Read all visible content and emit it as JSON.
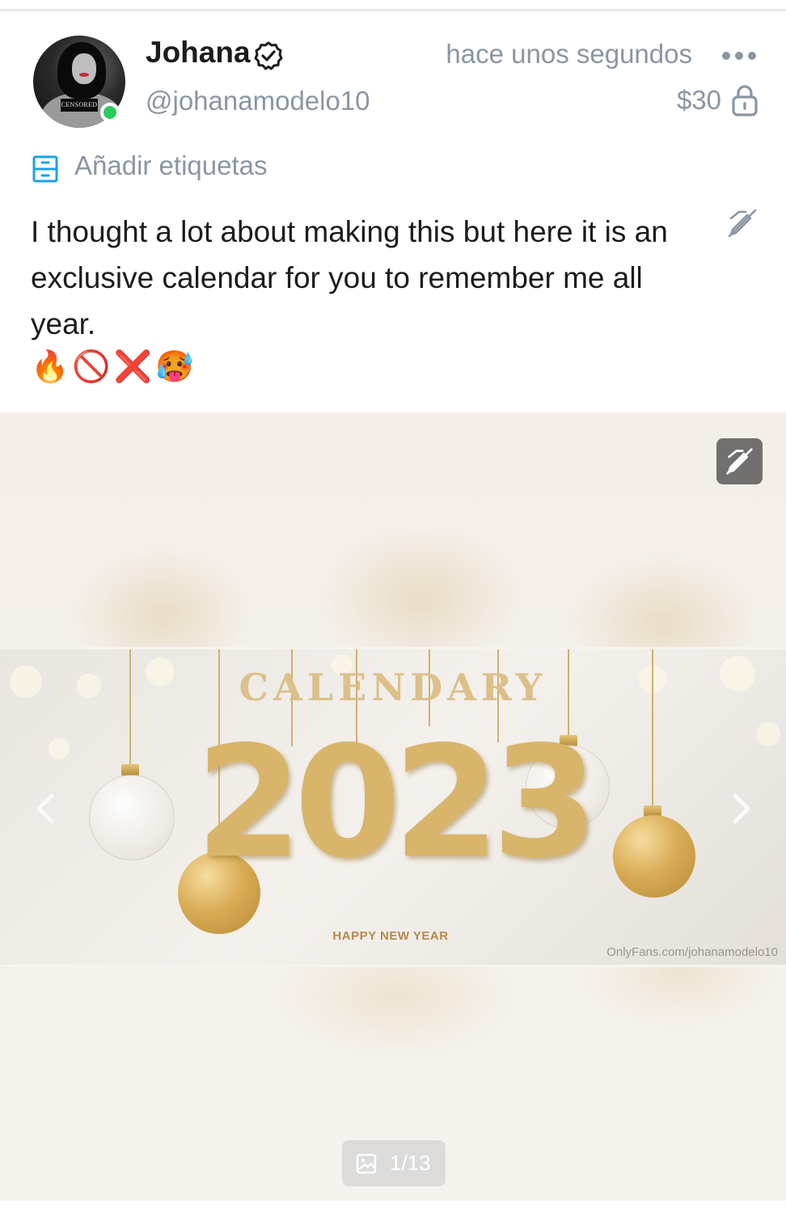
{
  "post": {
    "author": {
      "name": "Johana",
      "handle": "@johanamodelo10",
      "avatar_censor_label": "CENSORED",
      "online": true
    },
    "timestamp": "hace unos segundos",
    "price": "$30",
    "add_tags_label": "Añadir etiquetas",
    "caption": "I thought a lot about making this but here it is an exclusive calendar for you to remember me all year.",
    "emojis": "🔥🚫❌🥵"
  },
  "media": {
    "title_text": "CALENDARY",
    "year_text": "2023",
    "greeting": "HAPPY NEW YEAR",
    "watermark": "OnlyFans.com/johanamodelo10",
    "counter": "1/13"
  },
  "icons": {
    "verified": "verified-badge-icon",
    "more": "more-dots-icon",
    "lock": "lock-icon",
    "tags": "tag-list-icon",
    "edit_off": "edit-off-icon",
    "prev": "chevron-left-icon",
    "next": "chevron-right-icon",
    "image": "image-icon"
  },
  "colors": {
    "online": "#2ec95c",
    "muted_text": "#8a96a3",
    "tag_icon": "#1aa3e8",
    "gold": "#d8b56a"
  }
}
